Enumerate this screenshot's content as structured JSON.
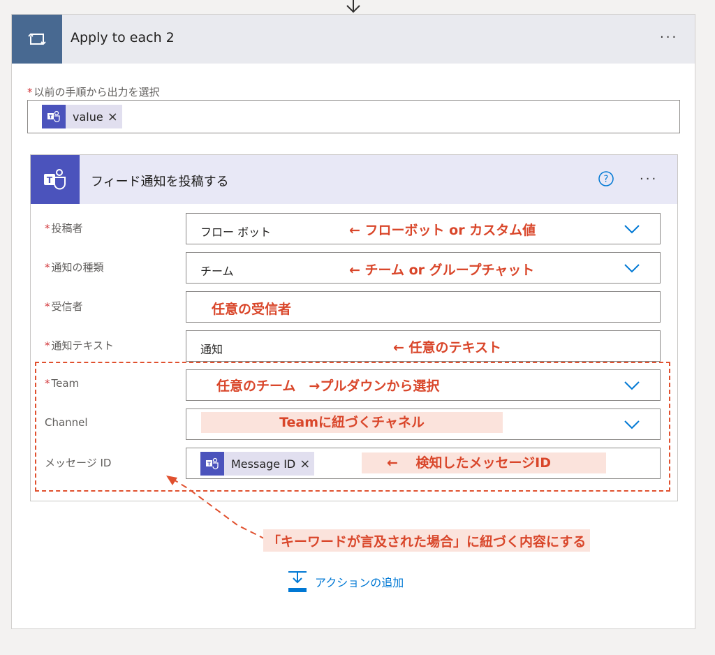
{
  "loop": {
    "title": "Apply to each 2",
    "more": "···",
    "select_label": "以前の手順から出力を選択",
    "token": "value",
    "token_close": "×"
  },
  "action": {
    "title": "フィード通知を投稿する",
    "help": "?",
    "more": "···"
  },
  "fields": {
    "poster": {
      "label": "投稿者",
      "value": "フロー ボット",
      "note": "← フローボット or カスタム値"
    },
    "type": {
      "label": "通知の種類",
      "value": "チーム",
      "note": "← チーム or グループチャット"
    },
    "recipient": {
      "label": "受信者",
      "note": "任意の受信者"
    },
    "text": {
      "label": "通知テキスト",
      "value": "通知",
      "note": "← 任意のテキスト"
    },
    "team": {
      "label": "Team",
      "note": "任意のチーム　→プルダウンから選択"
    },
    "channel": {
      "label": "Channel",
      "note": "Teamに紐づくチャネル"
    },
    "message_id": {
      "label": "メッセージ ID",
      "token": "Message ID",
      "token_close": "×",
      "note": "←　 検知したメッセージID"
    }
  },
  "required_mark": "*",
  "bottom_note": "「キーワードが言及された場合」に紐づく内容にする",
  "add_action": "アクションの追加",
  "colors": {
    "accent": "#0078d4",
    "teams": "#4b53bc",
    "loop": "#486991",
    "note": "#d9462a"
  }
}
